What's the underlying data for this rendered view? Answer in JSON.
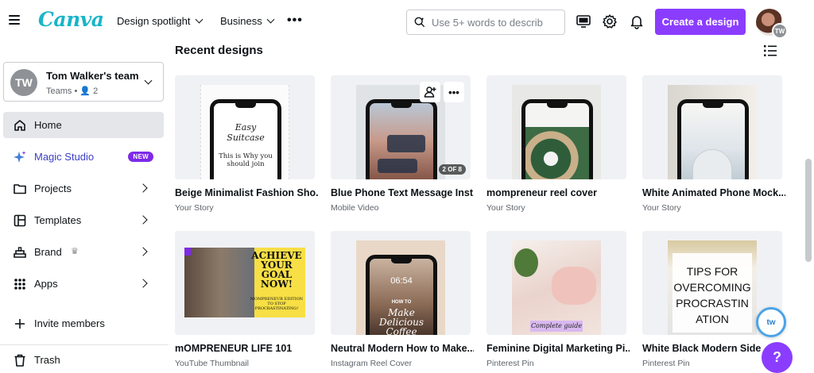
{
  "header": {
    "logo": "Canva",
    "nav": [
      {
        "label": "Design spotlight"
      },
      {
        "label": "Business"
      }
    ],
    "search_placeholder": "Use 5+ words to describ",
    "create_label": "Create a design",
    "avatar_initials": "TW",
    "accent": "#8b3dff"
  },
  "sidebar": {
    "team": {
      "initials": "TW",
      "name": "Tom Walker's team",
      "sub": "Teams • 👤 2"
    },
    "items": [
      {
        "label": "Home",
        "icon": "home-icon"
      },
      {
        "label": "Magic Studio",
        "icon": "sparkle-icon",
        "badge": "NEW"
      },
      {
        "label": "Projects",
        "icon": "folder-icon"
      },
      {
        "label": "Templates",
        "icon": "templates-icon"
      },
      {
        "label": "Brand",
        "icon": "brand-icon",
        "crown": "♛"
      },
      {
        "label": "Apps",
        "icon": "apps-icon"
      },
      {
        "label": "Invite members",
        "icon": "plus-icon"
      },
      {
        "label": "Trash",
        "icon": "trash-icon"
      }
    ]
  },
  "main": {
    "title": "Recent designs",
    "designs": [
      {
        "title": "Beige Minimalist Fashion Sho...",
        "type": "Your Story",
        "thumb_text_1": "Easy Suitcase",
        "thumb_text_2": "This is Why you should join"
      },
      {
        "title": "Blue Phone Text Message Inst...",
        "type": "Mobile Video",
        "badge": "2 OF 8"
      },
      {
        "title": "mompreneur reel cover",
        "type": "Your Story"
      },
      {
        "title": "White Animated Phone Mock...",
        "type": "Your Story"
      },
      {
        "title": "mOMPRENEUR LIFE 101",
        "type": "YouTube Thumbnail",
        "thumb_text_1": "ACHIEVE YOUR GOAL NOW!",
        "thumb_text_2": "MOMPRENEUR EDITION TO STOP PROCRASTINATING!"
      },
      {
        "title": "Neutral Modern How to Make...",
        "type": "Instagram Reel Cover",
        "thumb_text_1": "06:54",
        "thumb_text_2": "HOW TO",
        "thumb_text_3": "Make Delicious Coffee"
      },
      {
        "title": "Feminine Digital Marketing Pi...",
        "type": "Pinterest Pin",
        "thumb_text_1": "Complete guide"
      },
      {
        "title": "White Black Modern Side B...",
        "type": "Pinterest Pin",
        "thumb_text_1": "TIPS FOR OVERCOMING PROCRASTIN ATION"
      }
    ]
  },
  "floating": {
    "badge_text": "tw",
    "help_label": "?"
  }
}
